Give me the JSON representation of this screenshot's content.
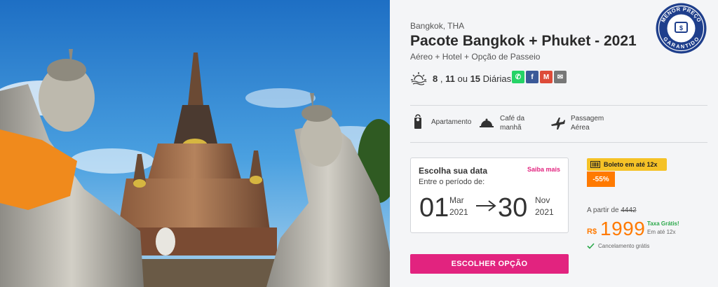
{
  "location": "Bangkok, THA",
  "title": "Pacote Bangkok + Phuket - 2021",
  "subtitle": "Aéreo + Hotel + Opção de Passeio",
  "diarias": {
    "d1": "8",
    "sep1": ",",
    "d2": "11",
    "sep2": "ou",
    "d3": "15",
    "label": "Diárias"
  },
  "share": [
    {
      "name": "whatsapp",
      "glyph": "✆",
      "color": "#25d366"
    },
    {
      "name": "facebook",
      "glyph": "f",
      "color": "#3b5998"
    },
    {
      "name": "gmail",
      "glyph": "M",
      "color": "#dd4b39"
    },
    {
      "name": "email",
      "glyph": "✉",
      "color": "#777777"
    }
  ],
  "features": {
    "apartamento": "Apartamento",
    "cafe_1": "Café da",
    "cafe_2": "manhã",
    "passagem_1": "Passagem",
    "passagem_2": "Aérea"
  },
  "dates": {
    "heading": "Escolha sua data",
    "more_link": "Saiba mais",
    "period_label": "Entre o período de:",
    "start_day": "01",
    "start_month": "Mar",
    "start_year": "2021",
    "end_day": "30",
    "end_month": "Nov",
    "end_year": "2021"
  },
  "boleto": "Boleto em até 12x",
  "discount": "-55%",
  "pricing": {
    "from_label": "A partir de",
    "old_price": "4442",
    "currency": "R$",
    "price": "1999",
    "tax_label": "Taxa Grátis!",
    "installments": "Em até 12x"
  },
  "cancel_label": "Cancelamento grátis",
  "cta_label": "ESCOLHER OPÇÃO",
  "seal": {
    "top": "MENOR PREÇO",
    "bottom": "GARANTIDO"
  },
  "colors": {
    "accent": "#e2237f",
    "price": "#ff7a00",
    "seal": "#1f3f8c",
    "boleto": "#f5c227"
  }
}
